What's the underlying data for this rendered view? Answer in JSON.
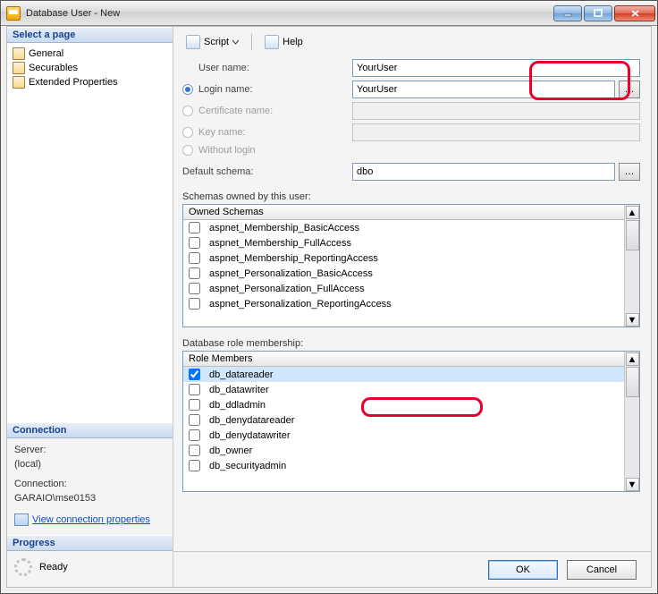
{
  "window": {
    "title": "Database User - New"
  },
  "sidebar": {
    "select_page": "Select a page",
    "items": [
      {
        "label": "General"
      },
      {
        "label": "Securables"
      },
      {
        "label": "Extended Properties"
      }
    ],
    "connection_hdr": "Connection",
    "server_label": "Server:",
    "server_value": "(local)",
    "connection_label": "Connection:",
    "connection_value": "GARAIO\\mse0153",
    "view_props": "View connection properties",
    "progress_hdr": "Progress",
    "progress_state": "Ready"
  },
  "toolbar": {
    "script": "Script",
    "help": "Help"
  },
  "form": {
    "user_name_label": "User name:",
    "user_name_value": "YourUser",
    "login_name_label": "Login name:",
    "login_name_value": "YourUser",
    "cert_label": "Certificate name:",
    "key_label": "Key name:",
    "without_login_label": "Without login",
    "default_schema_label": "Default schema:",
    "default_schema_value": "dbo"
  },
  "schemas": {
    "label": "Schemas owned by this user:",
    "header": "Owned Schemas",
    "items": [
      {
        "label": "aspnet_Membership_BasicAccess",
        "checked": false
      },
      {
        "label": "aspnet_Membership_FullAccess",
        "checked": false
      },
      {
        "label": "aspnet_Membership_ReportingAccess",
        "checked": false
      },
      {
        "label": "aspnet_Personalization_BasicAccess",
        "checked": false
      },
      {
        "label": "aspnet_Personalization_FullAccess",
        "checked": false
      },
      {
        "label": "aspnet_Personalization_ReportingAccess",
        "checked": false
      }
    ]
  },
  "roles": {
    "label": "Database role membership:",
    "header": "Role Members",
    "items": [
      {
        "label": "db_datareader",
        "checked": true,
        "selected": true
      },
      {
        "label": "db_datawriter",
        "checked": false
      },
      {
        "label": "db_ddladmin",
        "checked": false
      },
      {
        "label": "db_denydatareader",
        "checked": false
      },
      {
        "label": "db_denydatawriter",
        "checked": false
      },
      {
        "label": "db_owner",
        "checked": false
      },
      {
        "label": "db_securityadmin",
        "checked": false
      }
    ]
  },
  "buttons": {
    "ok": "OK",
    "cancel": "Cancel"
  }
}
